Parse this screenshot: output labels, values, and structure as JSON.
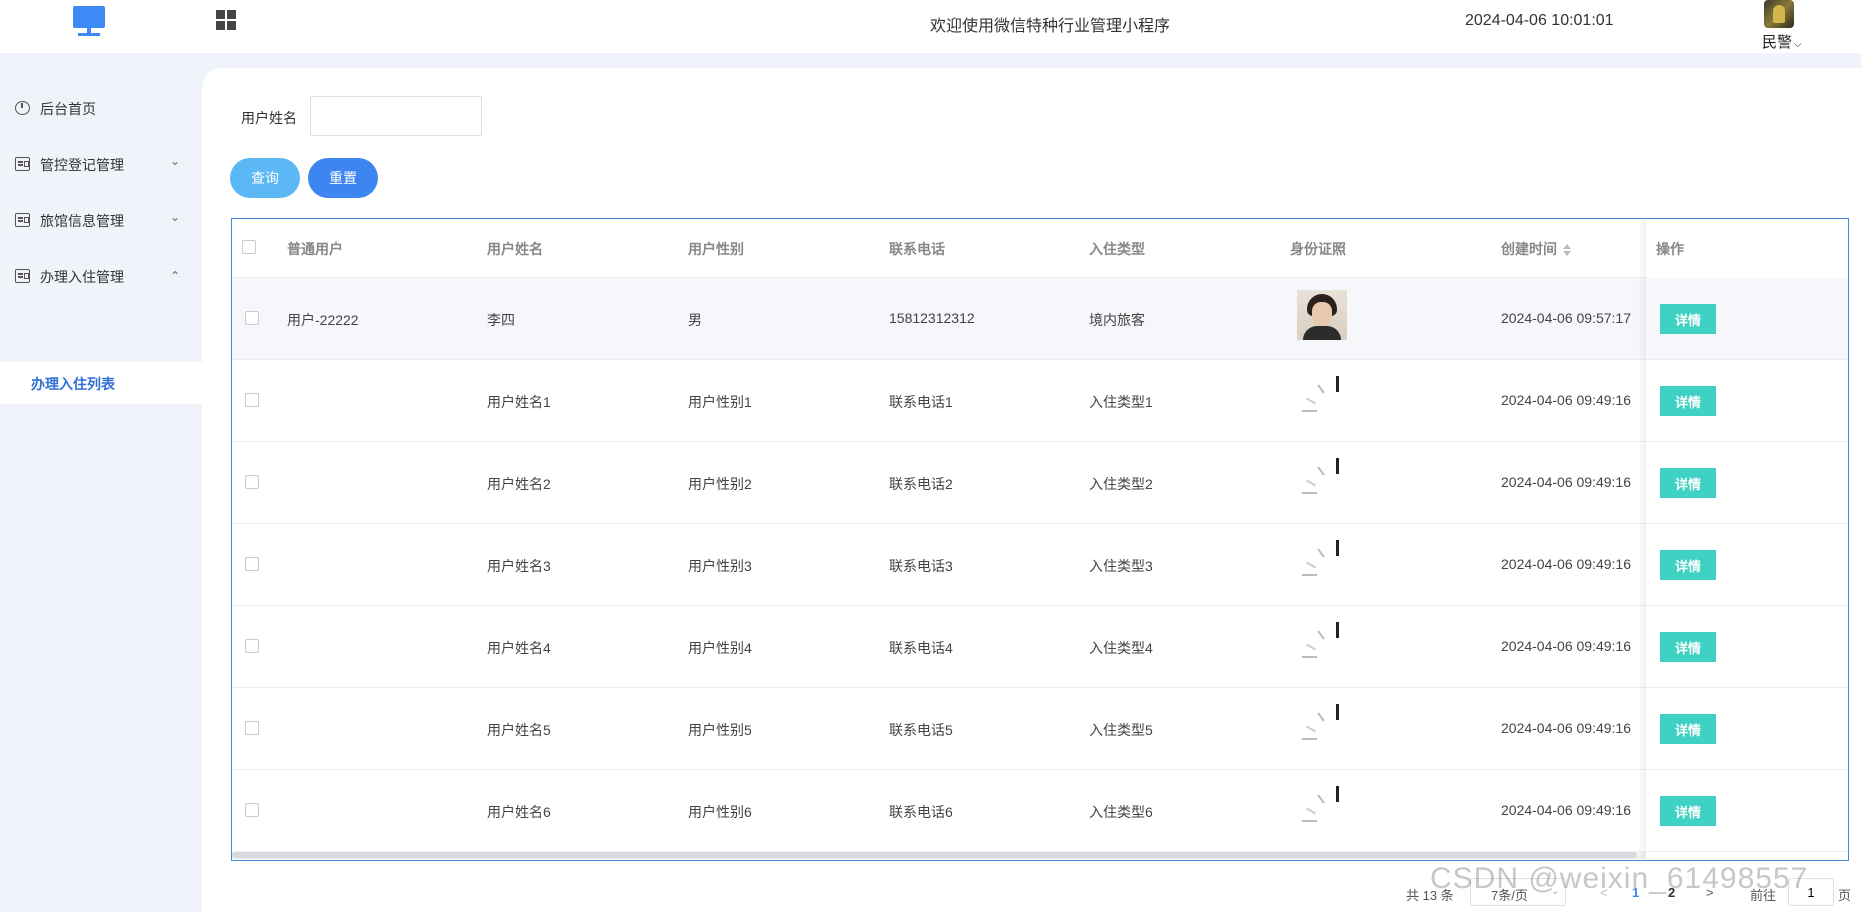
{
  "header": {
    "title": "欢迎使用微信特种行业管理小程序",
    "datetime": "2024-04-06 10:01:01",
    "user_role": "民警"
  },
  "sidebar": {
    "items": [
      {
        "label": "后台首页",
        "icon": "clock-icon"
      },
      {
        "label": "管控登记管理",
        "icon": "card-icon",
        "expanded": false
      },
      {
        "label": "旅馆信息管理",
        "icon": "card-icon",
        "expanded": false
      },
      {
        "label": "办理入住管理",
        "icon": "card-icon",
        "expanded": true
      }
    ],
    "submenu": {
      "label": "办理入住列表",
      "active": true
    }
  },
  "search": {
    "label": "用户姓名",
    "value": "",
    "query_label": "查询",
    "reset_label": "重置"
  },
  "table": {
    "columns": [
      "普通用户",
      "用户姓名",
      "用户性别",
      "联系电话",
      "入住类型",
      "身份证照",
      "创建时间",
      "操作"
    ],
    "detail_label": "详情",
    "rows": [
      {
        "user": "用户-22222",
        "name": "李四",
        "gender": "男",
        "phone": "15812312312",
        "type": "境内旅客",
        "photo": "loaded",
        "created": "2024-04-06 09:57:17"
      },
      {
        "user": "",
        "name": "用户姓名1",
        "gender": "用户性别1",
        "phone": "联系电话1",
        "type": "入住类型1",
        "photo": "loading",
        "created": "2024-04-06 09:49:16"
      },
      {
        "user": "",
        "name": "用户姓名2",
        "gender": "用户性别2",
        "phone": "联系电话2",
        "type": "入住类型2",
        "photo": "loading",
        "created": "2024-04-06 09:49:16"
      },
      {
        "user": "",
        "name": "用户姓名3",
        "gender": "用户性别3",
        "phone": "联系电话3",
        "type": "入住类型3",
        "photo": "loading",
        "created": "2024-04-06 09:49:16"
      },
      {
        "user": "",
        "name": "用户姓名4",
        "gender": "用户性别4",
        "phone": "联系电话4",
        "type": "入住类型4",
        "photo": "loading",
        "created": "2024-04-06 09:49:16"
      },
      {
        "user": "",
        "name": "用户姓名5",
        "gender": "用户性别5",
        "phone": "联系电话5",
        "type": "入住类型5",
        "photo": "loading",
        "created": "2024-04-06 09:49:16"
      },
      {
        "user": "",
        "name": "用户姓名6",
        "gender": "用户性别6",
        "phone": "联系电话6",
        "type": "入住类型6",
        "photo": "loading",
        "created": "2024-04-06 09:49:16"
      }
    ]
  },
  "pagination": {
    "total": "共 13 条",
    "page_size": "7条/页",
    "pages": [
      "1",
      "2"
    ],
    "current_page": "1",
    "goto_label": "前往",
    "goto_value": "1",
    "page_unit": "页"
  },
  "watermark": "CSDN @weixin_61498557",
  "colors": {
    "brand": "#3d8af7",
    "query_button": "#5bb8f5",
    "reset_button": "#3d85f0",
    "detail_button": "#3fd1c4",
    "active_menu": "#2f6fd6",
    "table_border": "#4a8ad8"
  }
}
